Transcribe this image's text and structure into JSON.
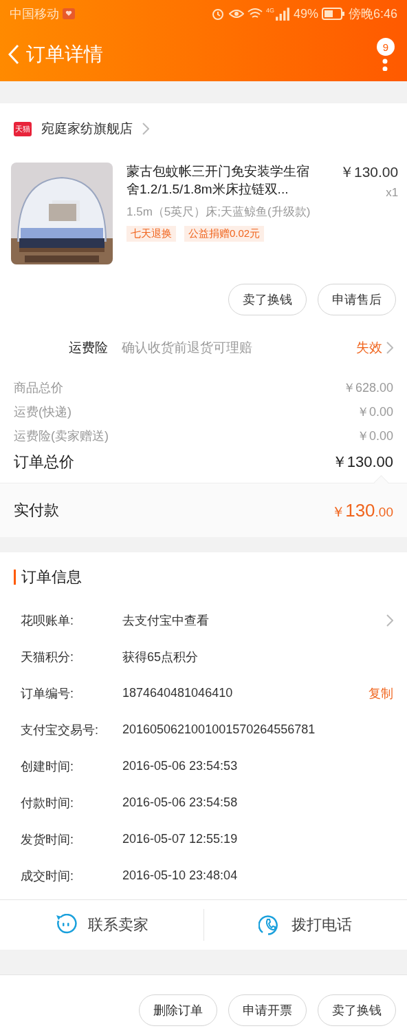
{
  "status_bar": {
    "carrier": "中国移动",
    "network": "4G",
    "battery": "49%",
    "time": "傍晚6:46"
  },
  "nav": {
    "title": "订单详情",
    "badge": "9"
  },
  "shop": {
    "logo": "天猫",
    "name": "宛庭家纺旗舰店"
  },
  "product": {
    "kind": "picture",
    "title": "蒙古包蚊帐三开门免安装学生宿舍1.2/1.5/1.8m米床拉链双...",
    "price": "￥130.00",
    "quantity": "x1",
    "sku": "1.5m（5英尺）床;天蓝鲸鱼(升级款)",
    "tags": [
      "七天退换",
      "公益捐赠0.02元"
    ]
  },
  "product_actions": [
    "卖了换钱",
    "申请售后"
  ],
  "insurance": {
    "label": "运费险",
    "description": "确认收货前退货可理赔",
    "status": "失效"
  },
  "costs": [
    {
      "label": "商品总价",
      "value": "￥628.00"
    },
    {
      "label": "运费(快递)",
      "value": "￥0.00"
    },
    {
      "label": "运费险(卖家赠送)",
      "value": "￥0.00"
    }
  ],
  "total": {
    "label": "订单总价",
    "value": "￥130.00"
  },
  "paid": {
    "label": "实付款",
    "currency": "￥",
    "amount": "130",
    "cents": ".00"
  },
  "order_info": {
    "title": "订单信息",
    "rows": [
      {
        "kind": "link",
        "label": "花呗账单:",
        "value": "去支付宝中查看"
      },
      {
        "kind": "plain",
        "label": "天猫积分:",
        "value": "获得65点积分"
      },
      {
        "kind": "copy",
        "label": "订单编号:",
        "value": "1874640481046410",
        "action": "复制"
      },
      {
        "kind": "plain",
        "label": "支付宝交易号:",
        "value": "2016050621001001570264556781"
      },
      {
        "kind": "plain",
        "label": "创建时间:",
        "value": "2016-05-06 23:54:53"
      },
      {
        "kind": "plain",
        "label": "付款时间:",
        "value": "2016-05-06 23:54:58"
      },
      {
        "kind": "plain",
        "label": "发货时间:",
        "value": "2016-05-07 12:55:19"
      },
      {
        "kind": "plain",
        "label": "成交时间:",
        "value": "2016-05-10 23:48:04"
      }
    ]
  },
  "contact": [
    {
      "kind": "chat",
      "label": "联系卖家"
    },
    {
      "kind": "phone",
      "label": "拨打电话"
    }
  ],
  "bottom_actions": [
    "删除订单",
    "申请开票",
    "卖了换钱"
  ]
}
